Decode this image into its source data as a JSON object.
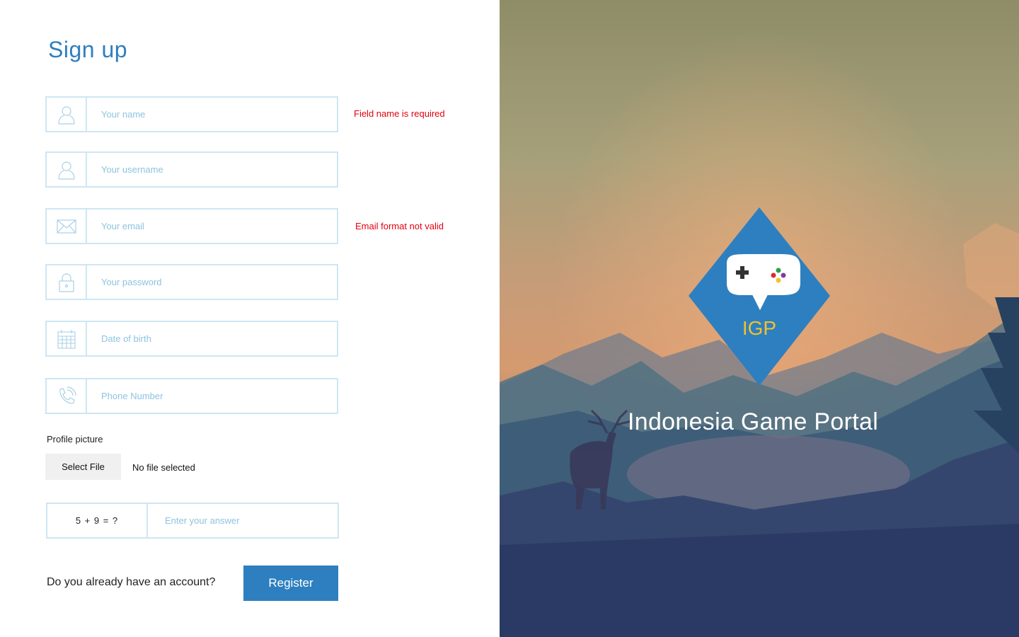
{
  "form": {
    "title": "Sign up",
    "fields": [
      {
        "placeholder": "Your name",
        "icon": "user-icon",
        "error": "Field name is required"
      },
      {
        "placeholder": "Your username",
        "icon": "user-icon",
        "error": ""
      },
      {
        "placeholder": "Your email",
        "icon": "envelope-icon",
        "error": "Email format not valid"
      },
      {
        "placeholder": "Your password",
        "icon": "lock-icon",
        "error": ""
      },
      {
        "placeholder": "Date of birth",
        "icon": "calendar-icon",
        "error": ""
      },
      {
        "placeholder": "Phone Number",
        "icon": "phone-icon",
        "error": ""
      }
    ],
    "profile_picture": {
      "label": "Profile picture",
      "button": "Select File",
      "status": "No file selected"
    },
    "captcha": {
      "question": "5 + 9 = ?",
      "placeholder": "Enter your answer"
    },
    "account_prompt": "Do you already have an account?",
    "register_label": "Register"
  },
  "hero": {
    "logo_text": "IGP",
    "title": "Indonesia Game Portal"
  },
  "colors": {
    "accent": "#2e7fbf",
    "border": "#cfe6f3",
    "error": "#e3000f",
    "placeholder": "#8ec3df"
  }
}
